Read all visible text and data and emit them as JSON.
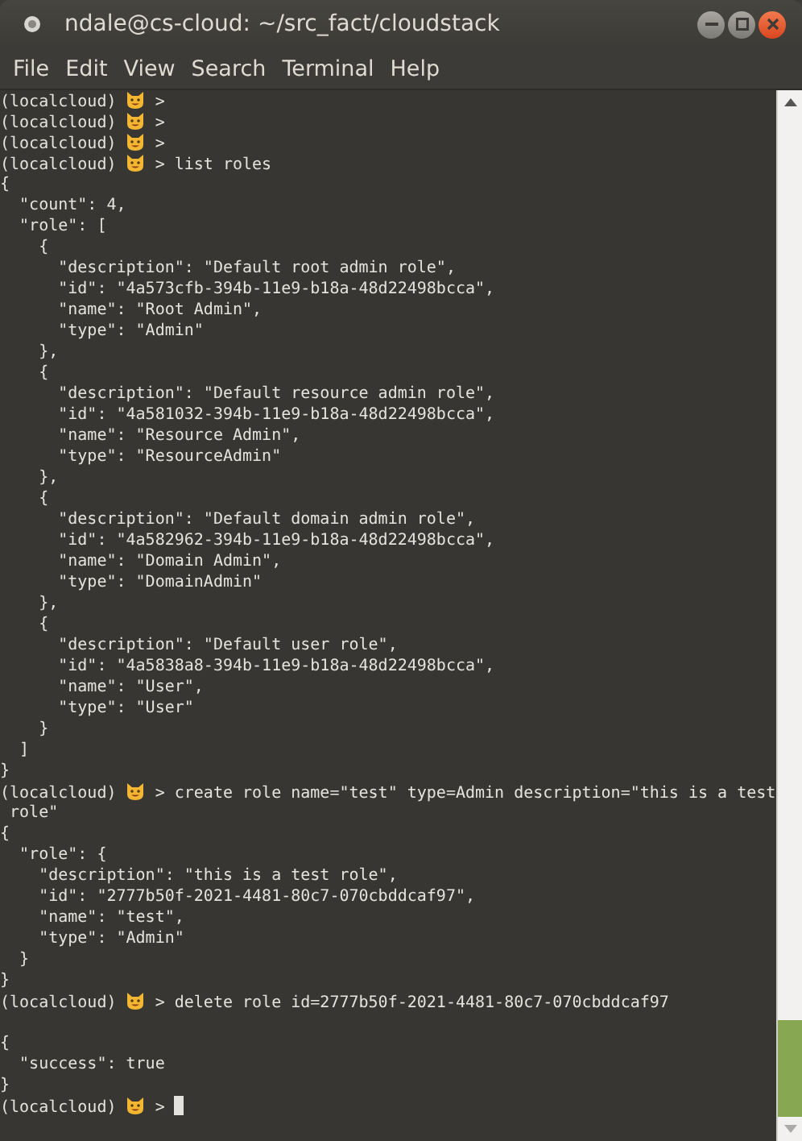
{
  "window": {
    "title": "ndale@cs-cloud: ~/src_fact/cloudstack"
  },
  "menu": [
    "File",
    "Edit",
    "View",
    "Search",
    "Terminal",
    "Help"
  ],
  "terminal": {
    "lines": [
      {
        "kind": "prompt",
        "env": "(localcloud)",
        "symbol": ">"
      },
      {
        "kind": "prompt",
        "env": "(localcloud)",
        "symbol": ">"
      },
      {
        "kind": "prompt",
        "env": "(localcloud)",
        "symbol": ">"
      },
      {
        "kind": "prompt",
        "env": "(localcloud)",
        "symbol": ">",
        "command": "list roles"
      },
      {
        "kind": "text",
        "text": "{"
      },
      {
        "kind": "text",
        "text": "  \"count\": 4,"
      },
      {
        "kind": "text",
        "text": "  \"role\": ["
      },
      {
        "kind": "text",
        "text": "    {"
      },
      {
        "kind": "text",
        "text": "      \"description\": \"Default root admin role\","
      },
      {
        "kind": "text",
        "text": "      \"id\": \"4a573cfb-394b-11e9-b18a-48d22498bcca\","
      },
      {
        "kind": "text",
        "text": "      \"name\": \"Root Admin\","
      },
      {
        "kind": "text",
        "text": "      \"type\": \"Admin\""
      },
      {
        "kind": "text",
        "text": "    },"
      },
      {
        "kind": "text",
        "text": "    {"
      },
      {
        "kind": "text",
        "text": "      \"description\": \"Default resource admin role\","
      },
      {
        "kind": "text",
        "text": "      \"id\": \"4a581032-394b-11e9-b18a-48d22498bcca\","
      },
      {
        "kind": "text",
        "text": "      \"name\": \"Resource Admin\","
      },
      {
        "kind": "text",
        "text": "      \"type\": \"ResourceAdmin\""
      },
      {
        "kind": "text",
        "text": "    },"
      },
      {
        "kind": "text",
        "text": "    {"
      },
      {
        "kind": "text",
        "text": "      \"description\": \"Default domain admin role\","
      },
      {
        "kind": "text",
        "text": "      \"id\": \"4a582962-394b-11e9-b18a-48d22498bcca\","
      },
      {
        "kind": "text",
        "text": "      \"name\": \"Domain Admin\","
      },
      {
        "kind": "text",
        "text": "      \"type\": \"DomainAdmin\""
      },
      {
        "kind": "text",
        "text": "    },"
      },
      {
        "kind": "text",
        "text": "    {"
      },
      {
        "kind": "text",
        "text": "      \"description\": \"Default user role\","
      },
      {
        "kind": "text",
        "text": "      \"id\": \"4a5838a8-394b-11e9-b18a-48d22498bcca\","
      },
      {
        "kind": "text",
        "text": "      \"name\": \"User\","
      },
      {
        "kind": "text",
        "text": "      \"type\": \"User\""
      },
      {
        "kind": "text",
        "text": "    }"
      },
      {
        "kind": "text",
        "text": "  ]"
      },
      {
        "kind": "text",
        "text": "}"
      },
      {
        "kind": "prompt",
        "env": "(localcloud)",
        "symbol": ">",
        "command": "create role name=\"test\" type=Admin description=\"this is a test"
      },
      {
        "kind": "text",
        "text": " role\""
      },
      {
        "kind": "text",
        "text": "{"
      },
      {
        "kind": "text",
        "text": "  \"role\": {"
      },
      {
        "kind": "text",
        "text": "    \"description\": \"this is a test role\","
      },
      {
        "kind": "text",
        "text": "    \"id\": \"2777b50f-2021-4481-80c7-070cbddcaf97\","
      },
      {
        "kind": "text",
        "text": "    \"name\": \"test\","
      },
      {
        "kind": "text",
        "text": "    \"type\": \"Admin\""
      },
      {
        "kind": "text",
        "text": "  }"
      },
      {
        "kind": "text",
        "text": "}"
      },
      {
        "kind": "prompt",
        "env": "(localcloud)",
        "symbol": ">",
        "command": "delete role id=2777b50f-2021-4481-80c7-070cbddcaf97"
      },
      {
        "kind": "blank"
      },
      {
        "kind": "text",
        "text": "{"
      },
      {
        "kind": "text",
        "text": "  \"success\": true"
      },
      {
        "kind": "text",
        "text": "}"
      },
      {
        "kind": "prompt",
        "env": "(localcloud)",
        "symbol": ">",
        "cursor": true
      }
    ]
  }
}
